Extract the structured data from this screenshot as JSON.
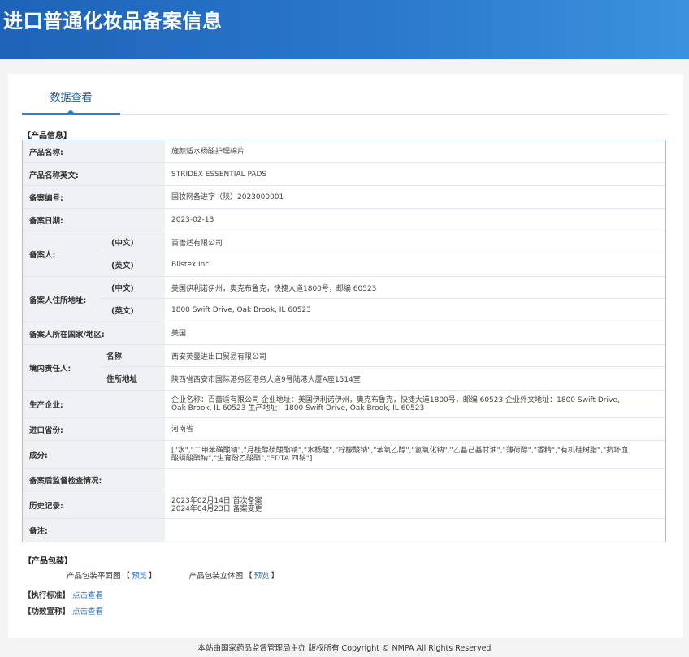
{
  "header": {
    "title": "进口普通化妆品备案信息"
  },
  "tab": {
    "label": "数据查看"
  },
  "sections": {
    "product_info": "【产品信息】",
    "product_package": "【产品包装】",
    "standard": "【执行标准】",
    "efficacy": "【功效宣称】"
  },
  "fields": {
    "product_name": {
      "label": "产品名称:",
      "value": "施颜适水杨酸护理棉片"
    },
    "product_name_en": {
      "label": "产品名称英文:",
      "value": "STRIDEX ESSENTIAL PADS"
    },
    "record_no": {
      "label": "备案编号:",
      "value": "国妆网备进字（陕）2023000001"
    },
    "record_date": {
      "label": "备案日期:",
      "value": "2023-02-13"
    },
    "filer": {
      "label": "备案人:",
      "cn_label": "(中文)",
      "cn_value": "百蕾适有限公司",
      "en_label": "(英文)",
      "en_value": "Blistex Inc."
    },
    "filer_address": {
      "label": "备案人住所地址:",
      "cn_label": "(中文)",
      "cn_value": "美国伊利诺伊州，奥克布鲁克，快捷大道1800号，邮编 60523",
      "en_label": "(英文)",
      "en_value": "1800 Swift Drive, Oak Brook, IL 60523"
    },
    "filer_country": {
      "label": "备案人所在国家/地区:",
      "value": "美国"
    },
    "domestic_agent": {
      "label": "境内责任人:",
      "name_label": "名称",
      "name_value": "西安英曼进出口贸易有限公司",
      "addr_label": "住所地址",
      "addr_value": "陕西省西安市国际港务区港务大道9号陆港大厦A座1514室"
    },
    "manufacturer": {
      "label": "生产企业:",
      "value": "企业名称：百蕾适有限公司 企业地址：美国伊利诺伊州，奥克布鲁克，快捷大道1800号，邮编 60523 企业外文地址：1800 Swift Drive, Oak Brook, IL 60523 生产地址：1800 Swift Drive, Oak Brook, IL 60523"
    },
    "import_province": {
      "label": "进口省份:",
      "value": "河南省"
    },
    "ingredients": {
      "label": "成分:",
      "value": "[\"水\",\"二甲苯磺酸钠\",\"月桂醇硫酸酯钠\",\"水杨酸\",\"柠檬酸钠\",\"苯氧乙醇\",\"氢氧化钠\",\"乙基己基甘油\",\"薄荷醇\",\"香精\",\"有机硅树脂\",\"抗坏血酸磷酸酯钠\",\"生育酚乙酸酯\",\"EDTA 四钠\"]"
    },
    "post_inspection": {
      "label": "备案后监督检查情况:",
      "value": ""
    },
    "history": {
      "label": "历史记录:",
      "line1": "2023年02月14日 首次备案",
      "line2": "2024年04月23日 备案变更"
    },
    "remarks": {
      "label": "备注:",
      "value": ""
    }
  },
  "package": {
    "flat_label": "产品包装平面图",
    "flat_link": "预览",
    "solid_label": "产品包装立体图",
    "solid_link": "预览",
    "bracket_open": "【",
    "bracket_close": "】"
  },
  "links": {
    "view_details": "点击查看"
  },
  "footer": {
    "text": "本站由国家药品监督管理局主办 版权所有 Copyright © NMPA All Rights Reserved"
  }
}
